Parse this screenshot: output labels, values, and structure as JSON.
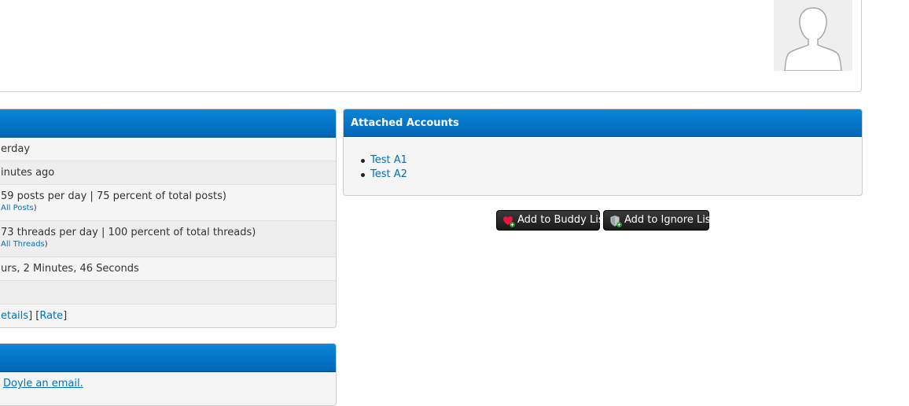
{
  "icons": {
    "avatar": "default-avatar-silhouette",
    "buddy": "heart-add-icon",
    "ignore": "shield-add-icon"
  },
  "colors": {
    "header_blue": "#0a86d8",
    "link": "#0072bc",
    "button_dark": "#222222"
  },
  "stats": {
    "rows": [
      {
        "text": "erday"
      },
      {
        "text": "inutes ago"
      },
      {
        "text": "59 posts per day | 75 percent of total posts)",
        "link": "All Posts",
        "close": ")"
      },
      {
        "text": "73 threads per day | 100 percent of total threads)",
        "link": "All Threads",
        "close": ")"
      },
      {
        "text": "urs, 2 Minutes, 46 Seconds"
      },
      {
        "text": ""
      }
    ],
    "details_link": "etails",
    "sep1": "] [",
    "rate_link": "Rate",
    "sep2": "]"
  },
  "contact": {
    "email_link": "Doyle an email."
  },
  "accounts": {
    "title": "Attached Accounts",
    "items": [
      "Test A1",
      "Test A2"
    ]
  },
  "buttons": {
    "buddy": "Add to Buddy List",
    "ignore": "Add to Ignore List"
  }
}
